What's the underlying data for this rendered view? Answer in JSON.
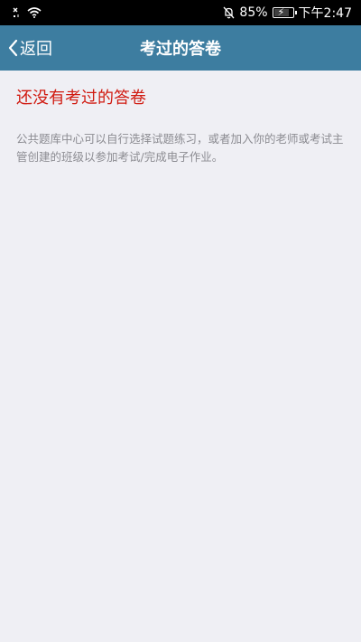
{
  "status_bar": {
    "battery_percent": "85%",
    "time": "下午2:47",
    "battery_level": 0.85,
    "icons": [
      "sim-no-signal-icon",
      "wifi-icon",
      "notifications-muted-icon",
      "battery-icon"
    ]
  },
  "nav": {
    "back_label": "返回",
    "title": "考过的答卷",
    "background_color": "#3d7da0"
  },
  "empty_state": {
    "title": "还没有考过的答卷",
    "description": "公共题库中心可以自行选择试题练习，或者加入你的老师或考试主管创建的班级以参加考试/完成电子作业。",
    "title_color": "#d01a10"
  }
}
